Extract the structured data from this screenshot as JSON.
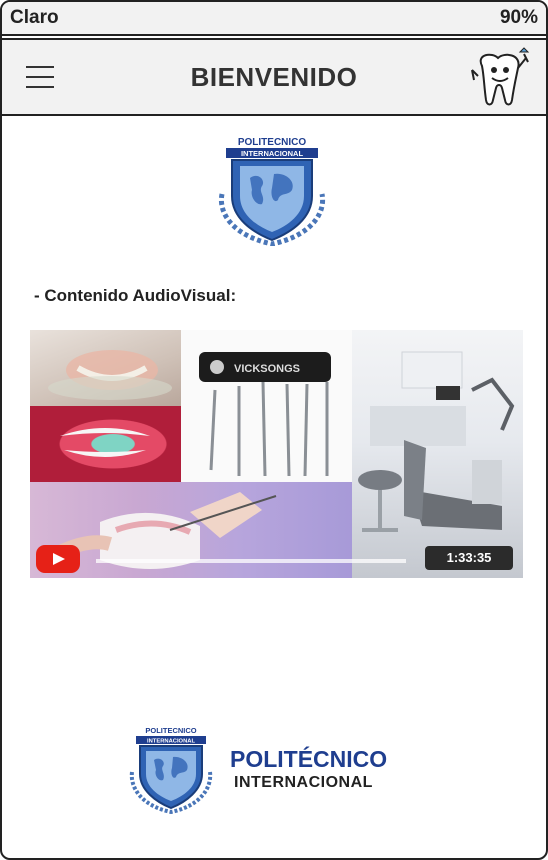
{
  "status_bar": {
    "carrier": "Claro",
    "battery": "90%"
  },
  "nav": {
    "title": "BIENVENIDO"
  },
  "logo": {
    "line1": "POLITECNICO",
    "line2": "INTERNACIONAL"
  },
  "content": {
    "heading": "- Contenido AudioVisual:"
  },
  "video": {
    "tool_kit_label": "VICKSONGS",
    "duration": "1:33:35"
  },
  "footer": {
    "name": "POLITÉCNICO",
    "subtitle": "INTERNACIONAL"
  },
  "colors": {
    "accent_blue": "#1f3e8f",
    "play_red": "#e62117"
  }
}
